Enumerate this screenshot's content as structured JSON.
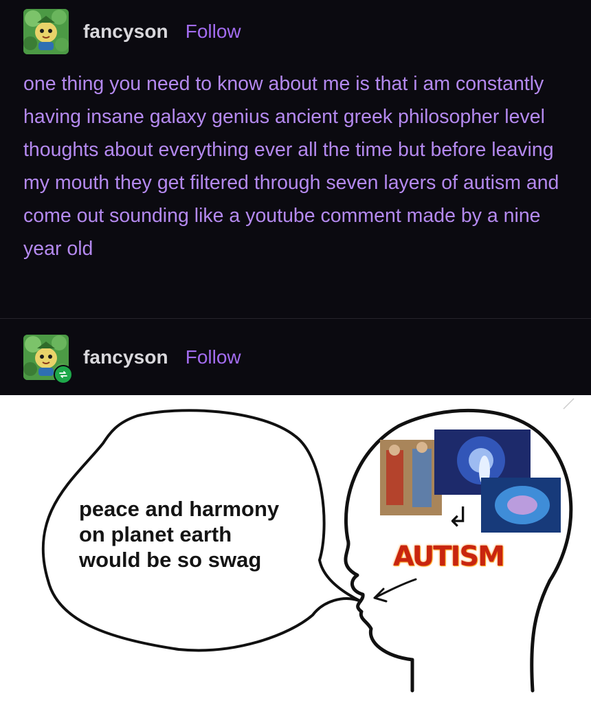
{
  "posts": [
    {
      "username": "fancyson",
      "follow_label": "Follow",
      "text": "one thing you need to know about me is that i am constantly having insane galaxy genius ancient greek philosopher level thoughts about everything ever all the time but before leaving my mouth they get filtered through seven layers of autism and come out sounding like a youtube comment made by a nine year old"
    },
    {
      "username": "fancyson",
      "follow_label": "Follow",
      "reblog_icon": "reblog-icon"
    }
  ],
  "meme": {
    "bubble_lines": [
      "peace and harmony",
      "on planet earth",
      "would be so swag"
    ],
    "brain_label": "AUTISM",
    "arrow": "↲"
  },
  "colors": {
    "background": "#0b0a10",
    "accent": "#a36cf0",
    "post_text": "#b489ef",
    "username": "#d9d8dc",
    "reblog_badge": "#1ea84a",
    "autism_red": "#c8250f"
  }
}
